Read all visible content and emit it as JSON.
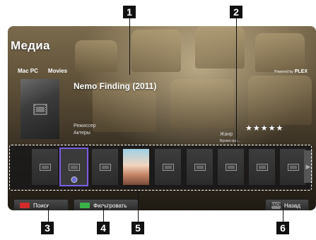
{
  "app": {
    "title": "Медиа"
  },
  "breadcrumb": [
    "Mac PC",
    "Movies"
  ],
  "branding": {
    "powered_by": "Powered by",
    "name": "PLEX"
  },
  "movie": {
    "title": "Nemo Finding (2011)",
    "director_label": "Режиссер",
    "actors_label": "Актеры",
    "genre_label": "Жанр",
    "duration_label": "Время про...",
    "rating_stars": 5
  },
  "buttons": {
    "search": {
      "label": "Поиск",
      "color": "#d32a2a"
    },
    "filter": {
      "label": "Фильтровать",
      "color": "#3bb24a"
    },
    "back": {
      "label": "Назад",
      "key": "BACK"
    }
  },
  "callouts": [
    "1",
    "2",
    "3",
    "4",
    "5",
    "6"
  ],
  "icons": {
    "film": "film-icon",
    "star": "star-icon",
    "arrow": "chevron-right-icon"
  },
  "accent_color": "#7a5de3"
}
